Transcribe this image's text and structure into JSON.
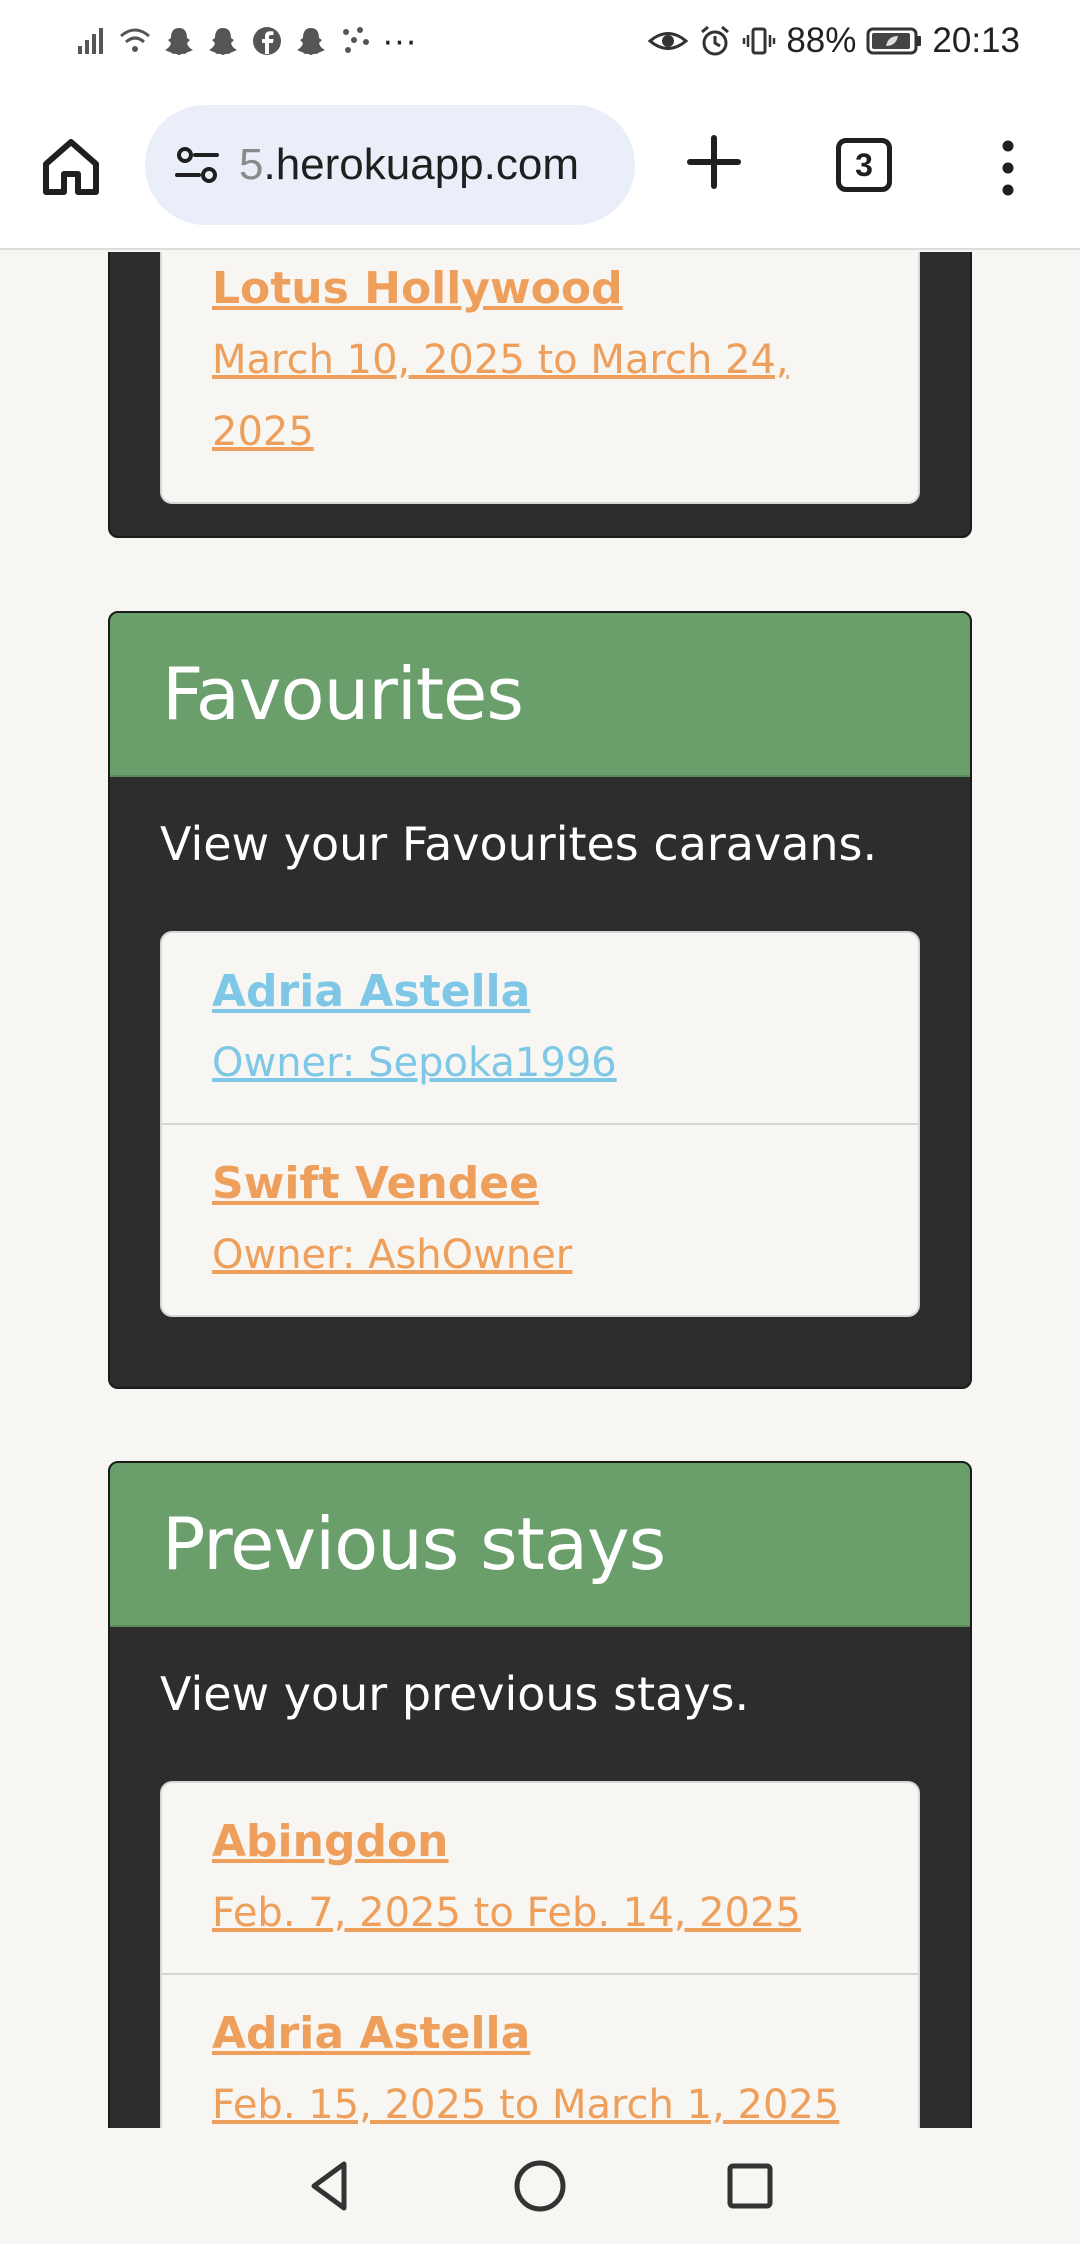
{
  "status_bar": {
    "notification_icons": [
      "signal-icon",
      "wifi-icon",
      "snapchat-icon",
      "snapchat-icon",
      "facebook-icon",
      "snapchat-icon",
      "dots-app-icon"
    ],
    "more": "···",
    "battery": "88%",
    "time": "20:13"
  },
  "browser": {
    "url_prefix": "5",
    "url_main": ".herokuapp.com",
    "tab_count": "3"
  },
  "sections": {
    "bookings_partial": {
      "items": [
        {
          "title": "Lotus Hollywood",
          "sub": "March 10, 2025 to March 24, 2025"
        }
      ]
    },
    "favourites": {
      "title": "Favourites",
      "description": "View your Favourites caravans.",
      "items": [
        {
          "title": "Adria Astella",
          "sub": "Owner: Sepoka1996"
        },
        {
          "title": "Swift Vendee",
          "sub": "Owner: AshOwner"
        }
      ]
    },
    "previous": {
      "title": "Previous stays",
      "description": "View your previous stays.",
      "items": [
        {
          "title": "Abingdon",
          "sub": "Feb. 7, 2025 to Feb. 14, 2025"
        },
        {
          "title": "Adria Astella",
          "sub": "Feb. 15, 2025 to March 1, 2025"
        }
      ]
    }
  },
  "colors": {
    "header_green": "#6a9f6c",
    "card_dark": "#2d2d2d",
    "link_orange": "#ee9f5c",
    "link_blue": "#7ec7e6"
  }
}
